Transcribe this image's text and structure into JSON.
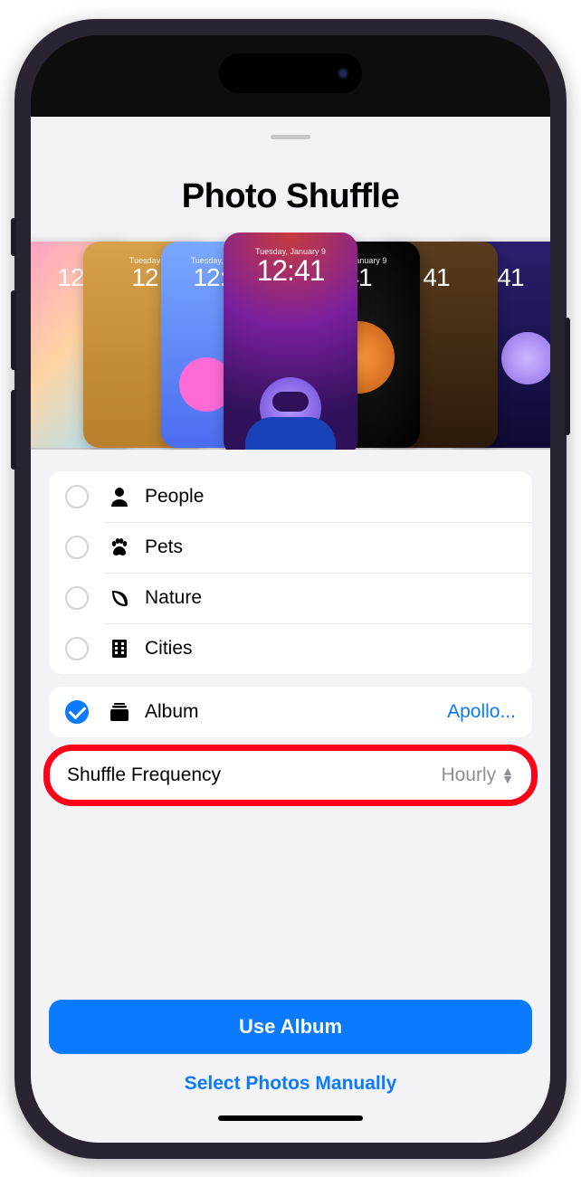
{
  "title": "Photo Shuffle",
  "carousel": {
    "time": "12:41",
    "day": "Tuesday, January 9"
  },
  "categories": [
    {
      "icon": "person-icon",
      "label": "People",
      "checked": false
    },
    {
      "icon": "paw-icon",
      "label": "Pets",
      "checked": false
    },
    {
      "icon": "leaf-icon",
      "label": "Nature",
      "checked": false
    },
    {
      "icon": "building-icon",
      "label": "Cities",
      "checked": false
    }
  ],
  "album": {
    "icon": "album-stack-icon",
    "label": "Album",
    "value": "Apollo...",
    "checked": true
  },
  "frequency": {
    "label": "Shuffle Frequency",
    "value": "Hourly"
  },
  "actions": {
    "primary": "Use Album",
    "secondary": "Select Photos Manually"
  }
}
